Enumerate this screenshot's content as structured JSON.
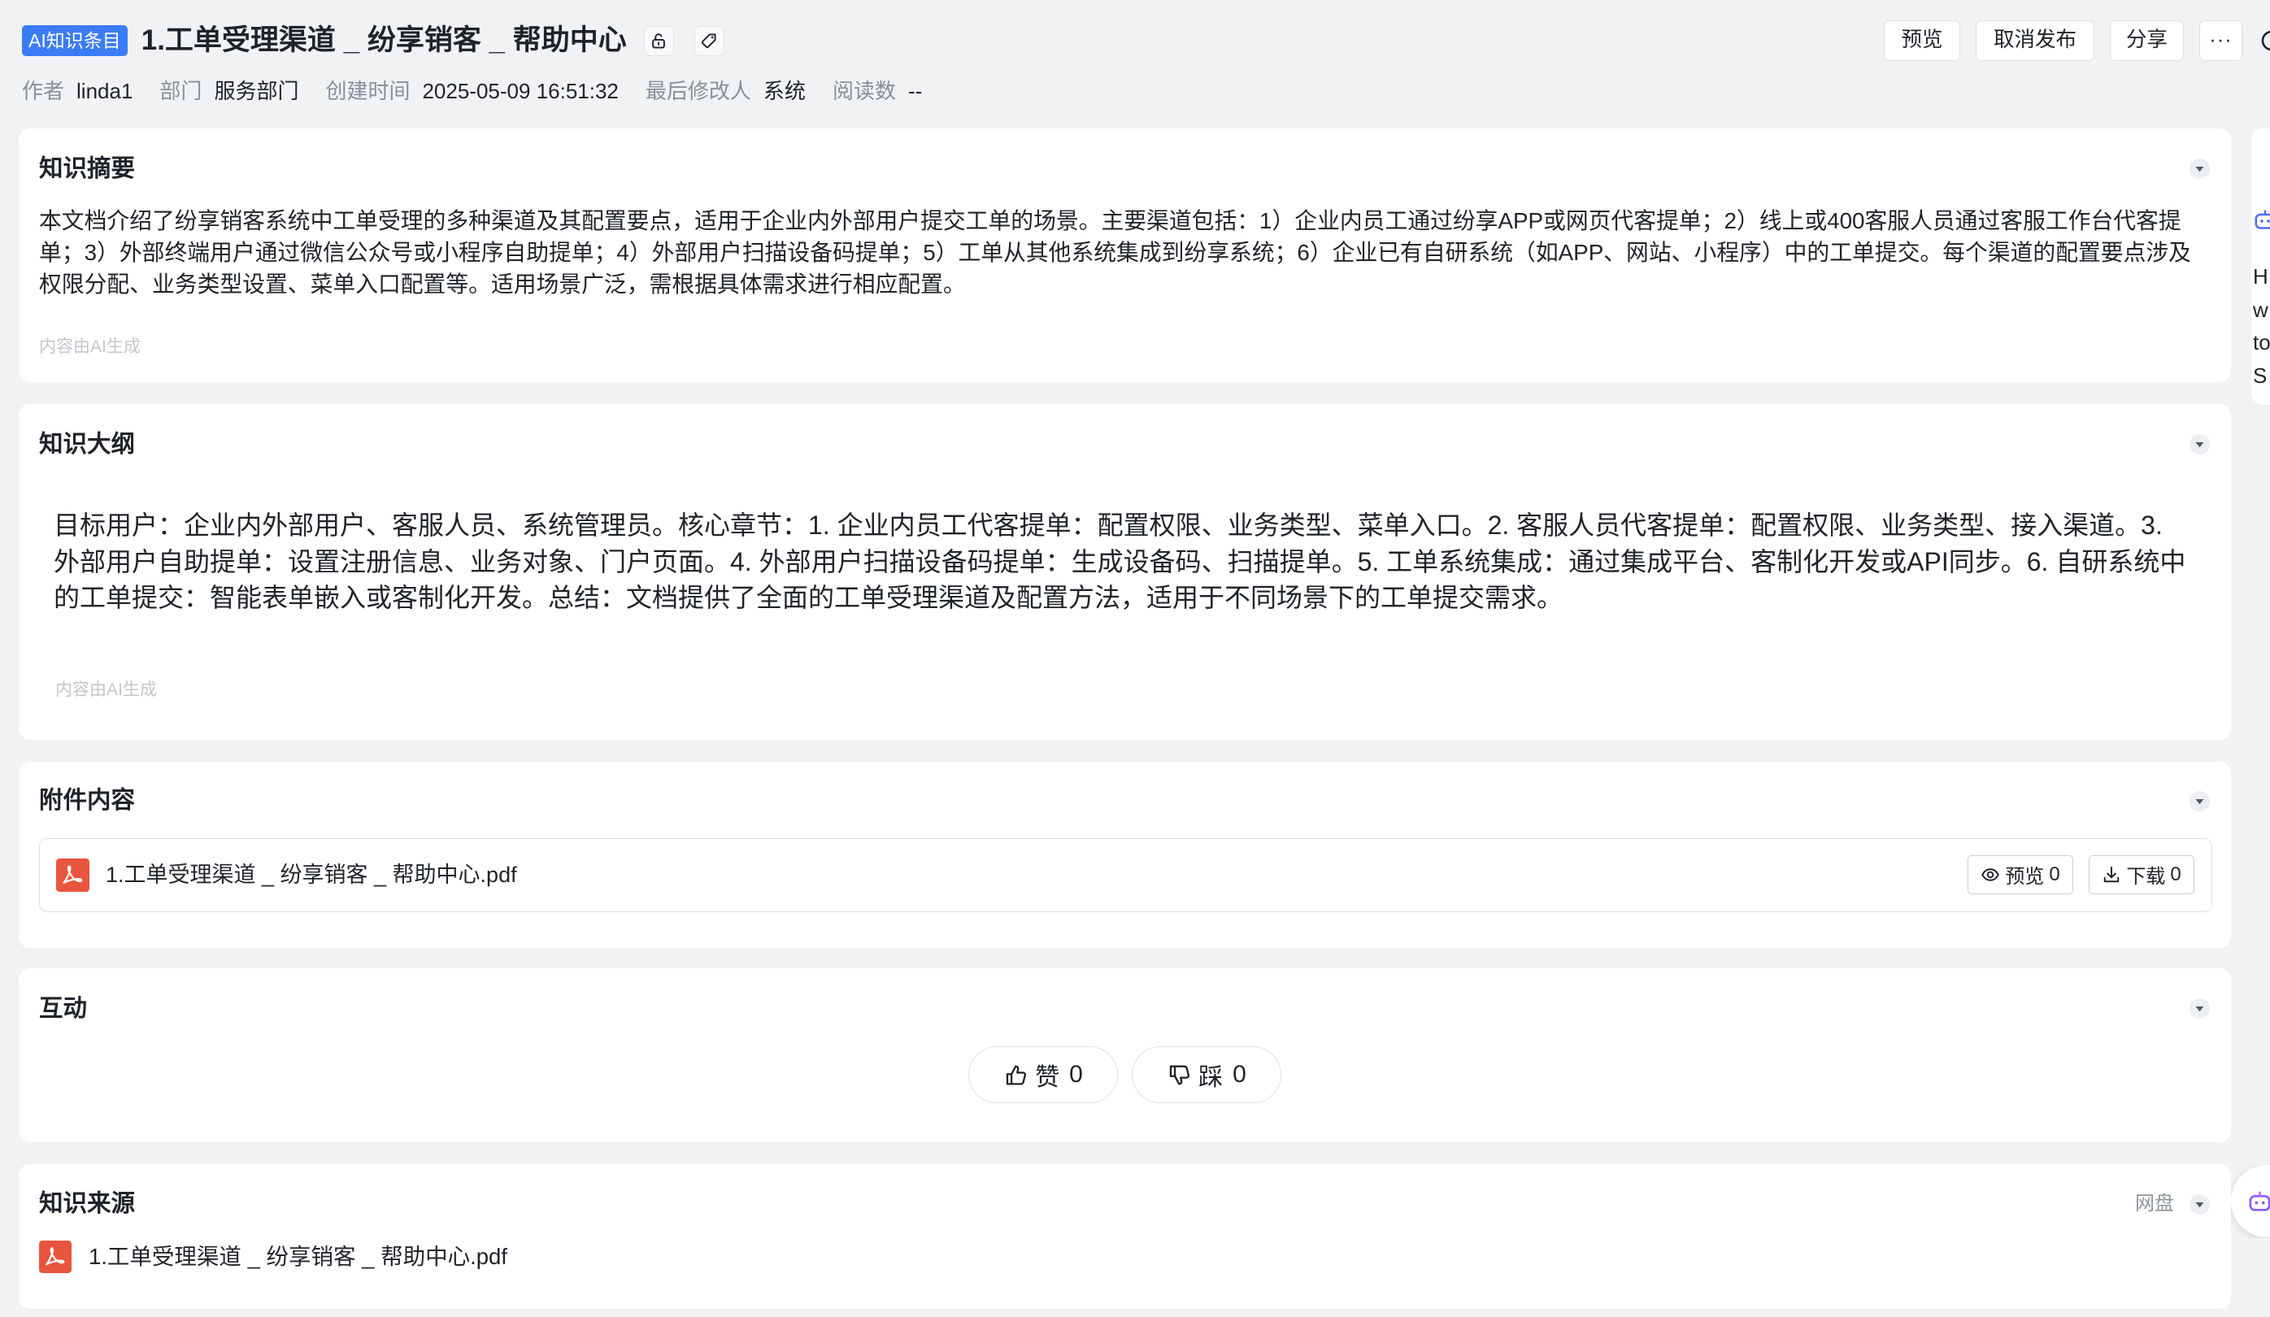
{
  "header": {
    "badge": "AI知识条目",
    "title": "1.工单受理渠道 _ 纷享销客 _ 帮助中心",
    "preview_button": "预览",
    "unpublish_button": "取消发布",
    "share_button": "分享",
    "more_button": "···"
  },
  "meta": {
    "author_label": "作者",
    "author": "linda1",
    "department_label": "部门",
    "department": "服务部门",
    "created_label": "创建时间",
    "created": "2025-05-09 16:51:32",
    "modifier_label": "最后修改人",
    "modifier": "系统",
    "reads_label": "阅读数",
    "reads": "--"
  },
  "summary": {
    "title": "知识摘要",
    "text": "本文档介绍了纷享销客系统中工单受理的多种渠道及其配置要点，适用于企业内外部用户提交工单的场景。主要渠道包括：1）企业内员工通过纷享APP或网页代客提单；2）线上或400客服人员通过客服工作台代客提单；3）外部终端用户通过微信公众号或小程序自助提单；4）外部用户扫描设备码提单；5）工单从其他系统集成到纷享系统；6）企业已有自研系统（如APP、网站、小程序）中的工单提交。每个渠道的配置要点涉及权限分配、业务类型设置、菜单入口配置等。适用场景广泛，需根据具体需求进行相应配置。",
    "footer": "内容由AI生成"
  },
  "outline": {
    "title": "知识大纲",
    "text": "目标用户：企业内外部用户、客服人员、系统管理员。核心章节：1. 企业内员工代客提单：配置权限、业务类型、菜单入口。2. 客服人员代客提单：配置权限、业务类型、接入渠道。3. 外部用户自助提单：设置注册信息、业务对象、门户页面。4. 外部用户扫描设备码提单：生成设备码、扫描提单。5. 工单系统集成：通过集成平台、客制化开发或API同步。6. 自研系统中的工单提交：智能表单嵌入或客制化开发。总结：文档提供了全面的工单受理渠道及配置方法，适用于不同场景下的工单提交需求。",
    "footer": "内容由AI生成"
  },
  "attachments": {
    "title": "附件内容",
    "items": [
      {
        "name": "1.工单受理渠道 _ 纷享销客 _ 帮助中心.pdf",
        "preview_label": "预览",
        "preview_count": "0",
        "download_label": "下载",
        "download_count": "0"
      }
    ]
  },
  "interaction": {
    "title": "互动",
    "like_label": "赞",
    "like_count": "0",
    "dislike_label": "踩",
    "dislike_count": "0"
  },
  "source": {
    "title": "知识来源",
    "origin": "网盘",
    "items": [
      {
        "name": "1.工单受理渠道 _ 纷享销客 _ 帮助中心.pdf"
      }
    ]
  },
  "assistant_panel": {
    "lines": [
      "H",
      "w",
      "to",
      "S"
    ]
  },
  "icons": {
    "lock": "unlock-icon",
    "tag": "tag-icon",
    "collapse": "chevron-down-icon",
    "file": "pdf-file-icon",
    "preview": "eye-icon",
    "download": "download-icon",
    "like": "thumbs-up-icon",
    "dislike": "thumbs-down-icon",
    "assistant": "robot-icon"
  },
  "colors": {
    "accent": "#3b7cf6",
    "page_background": "#f1f2f4",
    "card_background": "#ffffff",
    "pdf_red": "#e8553e",
    "muted_text": "#86909c",
    "assistant_blue": "#4f6ef7",
    "assistant_purple": "#8a5cf6"
  }
}
